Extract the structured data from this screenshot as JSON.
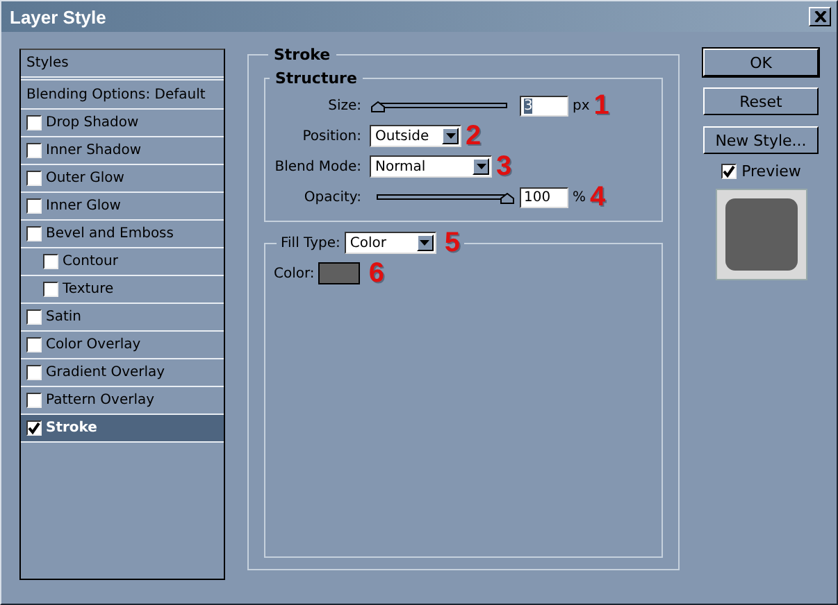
{
  "window": {
    "title": "Layer Style"
  },
  "styles_list": [
    {
      "label": "Styles",
      "kind": "header",
      "selected": false
    },
    {
      "label": "Blending Options: Default",
      "kind": "plain",
      "selected": false
    },
    {
      "label": "Drop Shadow",
      "kind": "check",
      "checked": false,
      "selected": false
    },
    {
      "label": "Inner Shadow",
      "kind": "check",
      "checked": false,
      "selected": false
    },
    {
      "label": "Outer Glow",
      "kind": "check",
      "checked": false,
      "selected": false
    },
    {
      "label": "Inner Glow",
      "kind": "check",
      "checked": false,
      "selected": false
    },
    {
      "label": "Bevel and Emboss",
      "kind": "check",
      "checked": false,
      "selected": false,
      "children": [
        {
          "label": "Contour",
          "kind": "check",
          "checked": false,
          "selected": false
        },
        {
          "label": "Texture",
          "kind": "check",
          "checked": false,
          "selected": false
        }
      ]
    },
    {
      "label": "Satin",
      "kind": "check",
      "checked": false,
      "selected": false
    },
    {
      "label": "Color Overlay",
      "kind": "check",
      "checked": false,
      "selected": false
    },
    {
      "label": "Gradient Overlay",
      "kind": "check",
      "checked": false,
      "selected": false
    },
    {
      "label": "Pattern Overlay",
      "kind": "check",
      "checked": false,
      "selected": false
    },
    {
      "label": "Stroke",
      "kind": "check",
      "checked": true,
      "selected": true
    }
  ],
  "stroke": {
    "title": "Stroke",
    "structure": {
      "title": "Structure",
      "size": {
        "label": "Size:",
        "level": 0.01,
        "value": "3",
        "text_selected": true,
        "unit": "px",
        "annotation": "1"
      },
      "position": {
        "label": "Position:",
        "value": "Outside",
        "annotation": "2"
      },
      "blend_mode": {
        "label": "Blend Mode:",
        "value": "Normal",
        "annotation": "3"
      },
      "opacity": {
        "label": "Opacity:",
        "level": 1,
        "value": "100",
        "unit": "%",
        "annotation": "4"
      }
    },
    "fill_type": {
      "label": "Fill Type:",
      "value": "Color",
      "annotation": "5"
    },
    "color": {
      "label": "Color:",
      "color": "#5f5f5f",
      "annotation": "6"
    }
  },
  "buttons": [
    {
      "label": "OK",
      "default": true
    },
    {
      "label": "Reset",
      "default": false
    },
    {
      "label": "New Style...",
      "default": false
    }
  ],
  "preview": {
    "label": "Preview",
    "checked": true
  }
}
